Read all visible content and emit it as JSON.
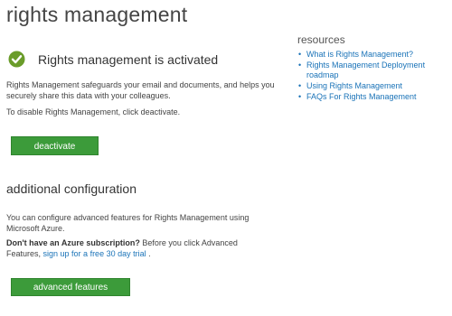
{
  "page": {
    "title": "rights management"
  },
  "status": {
    "icon": "check-icon",
    "text": "Rights management is activated",
    "color": "#6a9c2a"
  },
  "description": {
    "line1": "Rights Management safeguards your email and documents, and helps you securely share this data with your colleagues.",
    "line2": "To disable Rights Management, click deactivate."
  },
  "buttons": {
    "deactivate_label": "deactivate",
    "advanced_label": "advanced features",
    "color": "#3c9b3a"
  },
  "additional": {
    "heading": "additional configuration",
    "text1": "You can configure advanced features for Rights Management using Microsoft Azure.",
    "bold": "Don't have an Azure subscription?",
    "text2": " Before you click Advanced Features, ",
    "link": "sign up for a free 30 day trial",
    "text3": " ."
  },
  "resources": {
    "heading": "resources",
    "links": [
      "What is Rights Management?",
      "Rights Management Deployment roadmap",
      "Using Rights Management",
      "FAQs For Rights Management"
    ],
    "link_color": "#1a73b8"
  }
}
